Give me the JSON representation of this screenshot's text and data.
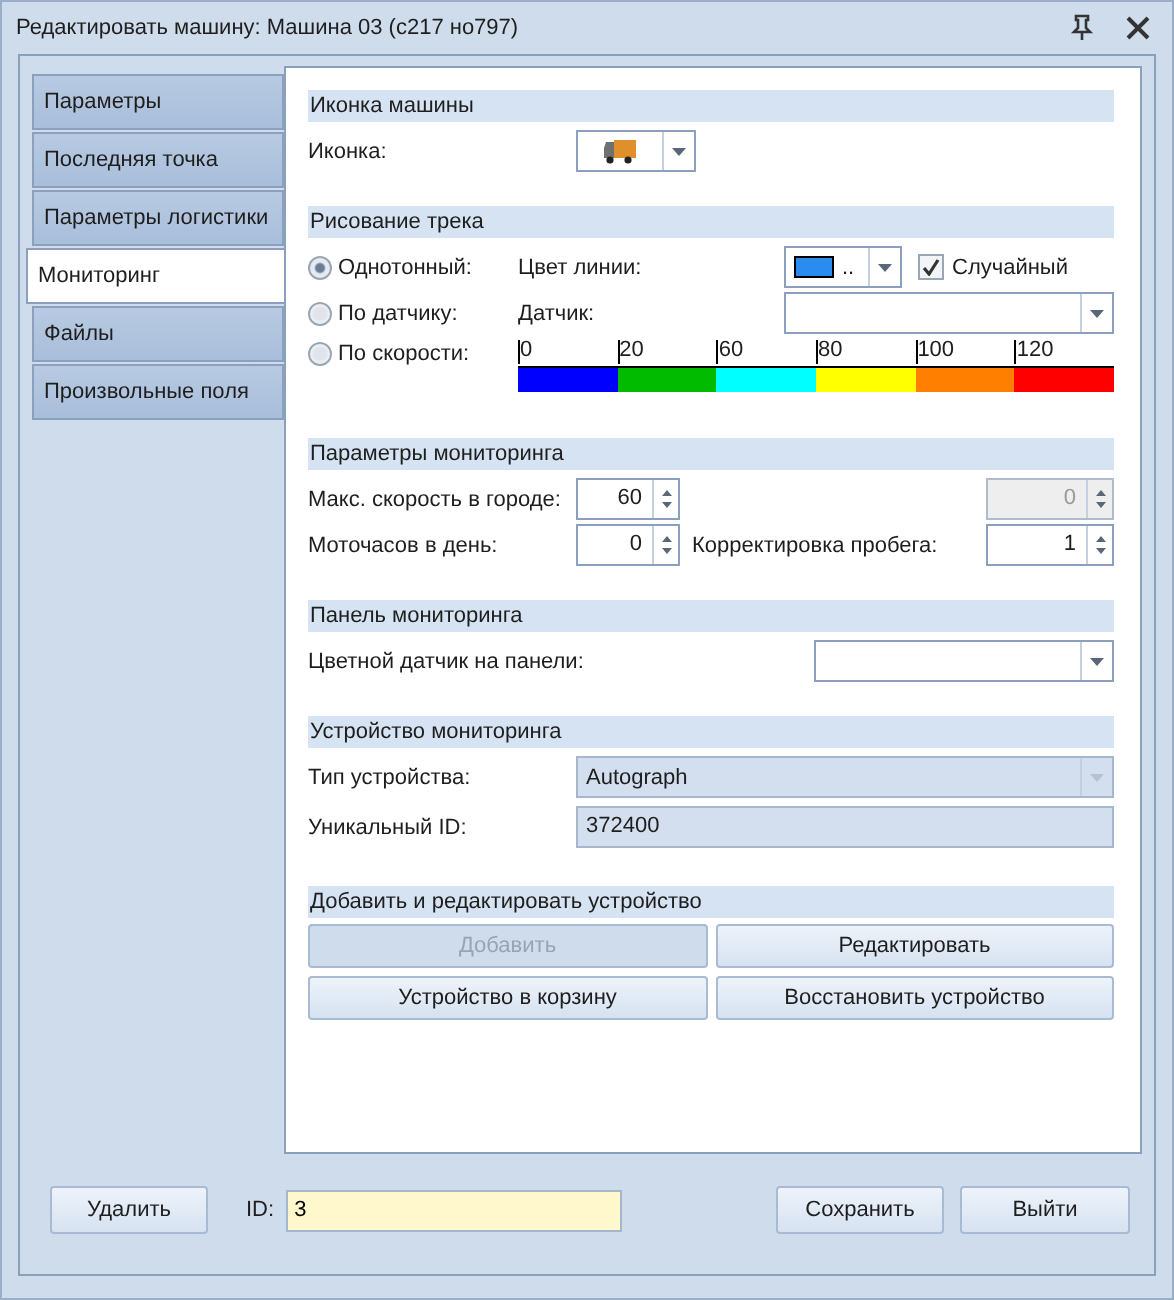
{
  "window": {
    "title": "Редактировать машину: Машина 03 (с217 но797)"
  },
  "tabs": [
    {
      "label": "Параметры",
      "selected": false
    },
    {
      "label": "Последняя точка",
      "selected": false
    },
    {
      "label": "Параметры логистики",
      "selected": false
    },
    {
      "label": "Мониторинг",
      "selected": true
    },
    {
      "label": "Файлы",
      "selected": false
    },
    {
      "label": "Произвольные поля",
      "selected": false
    }
  ],
  "vehicle_icon": {
    "heading": "Иконка машины",
    "label": "Иконка:"
  },
  "track_drawing": {
    "heading": "Рисование трека",
    "modes": [
      {
        "label": "Однотонный:",
        "selected": true
      },
      {
        "label": "По датчику:",
        "selected": false
      },
      {
        "label": "По скорости:",
        "selected": false
      }
    ],
    "line_color_label": "Цвет линии:",
    "swatch_text": "..",
    "random": {
      "label": "Случайный",
      "checked": true
    },
    "sensor_label": "Датчик:",
    "speed_scale": [
      {
        "label": "0",
        "color": "#0000ff"
      },
      {
        "label": "20",
        "color": "#00bb00"
      },
      {
        "label": "60",
        "color": "#00ffff"
      },
      {
        "label": "80",
        "color": "#ffff00"
      },
      {
        "label": "100",
        "color": "#ff8000"
      },
      {
        "label": "120",
        "color": "#ff0000"
      }
    ]
  },
  "monitoring_params": {
    "heading": "Параметры мониторинга",
    "rows": [
      [
        {
          "label": "Макс. скорость в городе:",
          "value": "60",
          "disabled": false
        },
        {
          "value": "0",
          "disabled": true
        }
      ],
      [
        {
          "label": "Моточасов в день:",
          "value": "0",
          "disabled": false
        },
        {
          "label": "Корректировка пробега:",
          "value": "1",
          "disabled": false
        }
      ]
    ]
  },
  "monitoring_panel": {
    "heading": "Панель мониторинга",
    "label": "Цветной датчик на панели:"
  },
  "device": {
    "heading": "Устройство мониторинга",
    "type_label": "Тип устройства:",
    "type_value": "Autograph",
    "type_disabled": true,
    "id_label": "Уникальный ID:",
    "id_value": "372400"
  },
  "device_actions": {
    "heading": "Добавить и редактировать устройство",
    "buttons": [
      {
        "label": "Добавить",
        "disabled": true
      },
      {
        "label": "Редактировать",
        "disabled": false
      },
      {
        "label": "Устройство в корзину",
        "disabled": false
      },
      {
        "label": "Восстановить устройство",
        "disabled": false
      }
    ]
  },
  "footer": {
    "delete": "Удалить",
    "id_label": "ID:",
    "id_value": "3",
    "save": "Сохранить",
    "exit": "Выйти"
  }
}
